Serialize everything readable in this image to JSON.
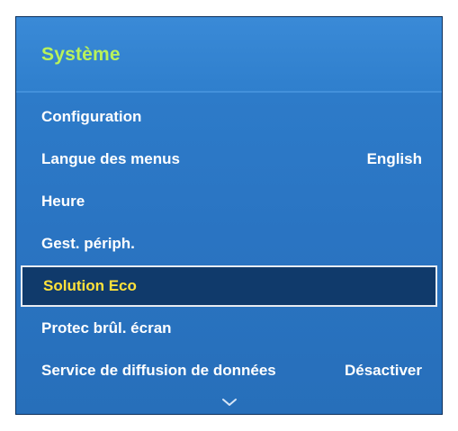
{
  "panel": {
    "title": "Système"
  },
  "menu": {
    "items": [
      {
        "label": "Configuration",
        "value": ""
      },
      {
        "label": "Langue des menus",
        "value": "English"
      },
      {
        "label": "Heure",
        "value": ""
      },
      {
        "label": "Gest. périph.",
        "value": ""
      },
      {
        "label": "Solution Eco",
        "value": "",
        "selected": true
      },
      {
        "label": "Protec brûl. écran",
        "value": ""
      },
      {
        "label": "Service de diffusion de données",
        "value": "Désactiver"
      }
    ]
  },
  "colors": {
    "panel_bg": "#2a74c2",
    "title": "#b9f25a",
    "selected_bg": "#103a6b",
    "selected_text": "#ffe23a",
    "item_text": "#ffffff"
  },
  "icons": {
    "scroll_down": "chevron-down-icon"
  }
}
